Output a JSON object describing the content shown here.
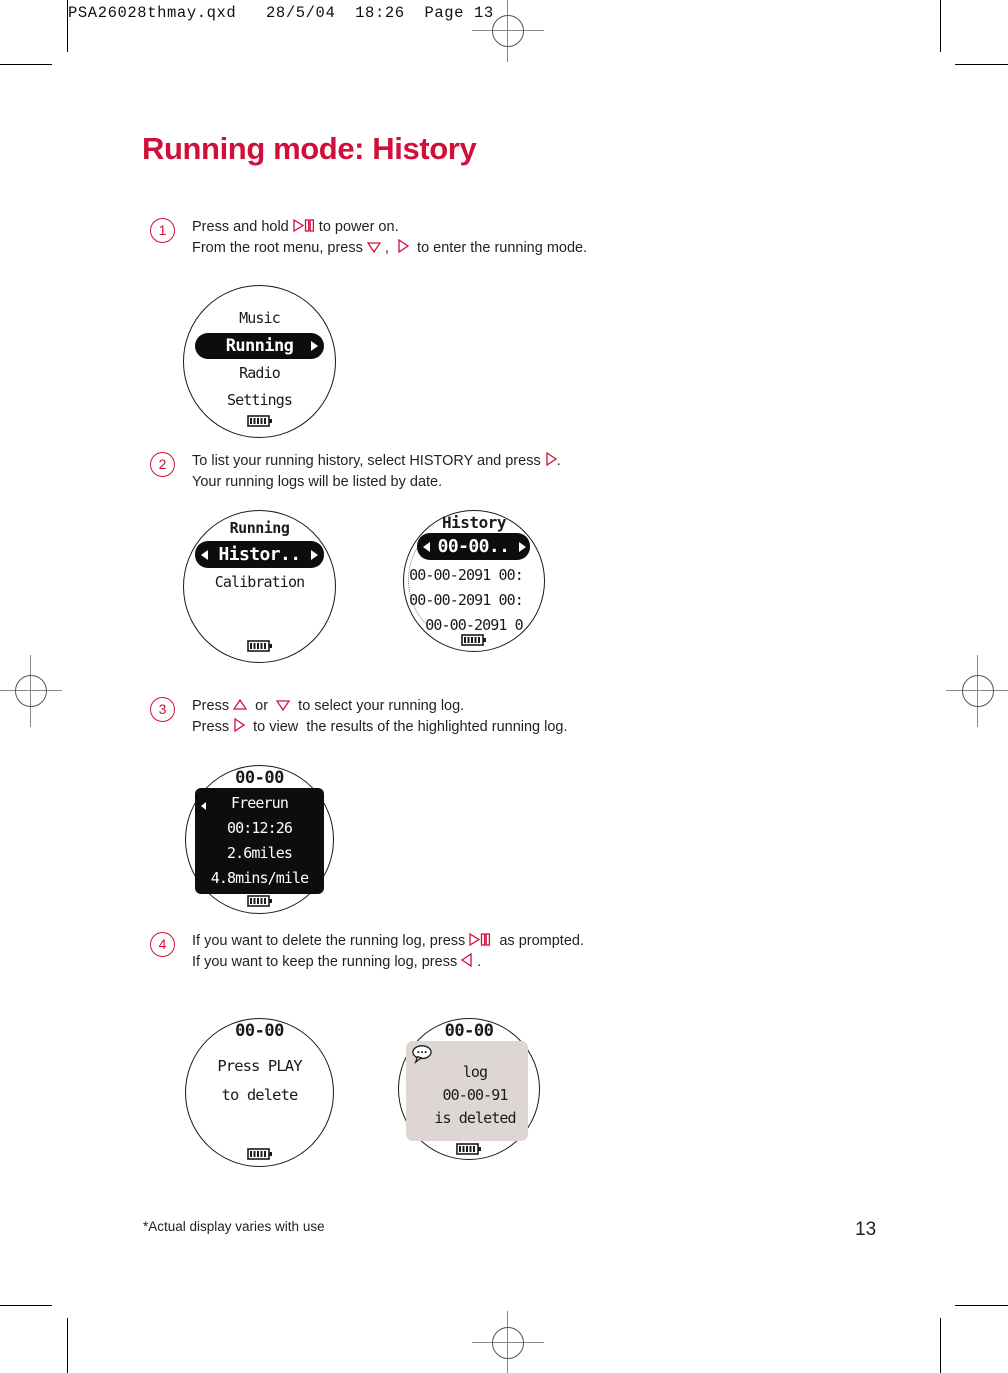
{
  "print_header": "PSA26028thmay.qxd   28/5/04  18:26  Page 13",
  "title": "Running mode: History",
  "steps": [
    {
      "number": "1",
      "lines": [
        {
          "parts": [
            {
              "t": "text",
              "v": "Press and hold "
            },
            {
              "t": "icon",
              "v": "play-pause-icon"
            },
            {
              "t": "text",
              "v": " to power on."
            }
          ]
        },
        {
          "parts": [
            {
              "t": "text",
              "v": "From the root menu, press "
            },
            {
              "t": "icon",
              "v": "down-triangle-icon"
            },
            {
              "t": "text",
              "v": " ,  "
            },
            {
              "t": "icon",
              "v": "right-triangle-icon"
            },
            {
              "t": "text",
              "v": "  to enter the running mode."
            }
          ]
        }
      ]
    },
    {
      "number": "2",
      "lines": [
        {
          "parts": [
            {
              "t": "text",
              "v": "To list your running history, select HISTORY and press "
            },
            {
              "t": "icon",
              "v": "right-triangle-icon"
            },
            {
              "t": "text",
              "v": "."
            }
          ]
        },
        {
          "parts": [
            {
              "t": "text",
              "v": "Your running logs will be listed by date."
            }
          ]
        }
      ]
    },
    {
      "number": "3",
      "lines": [
        {
          "parts": [
            {
              "t": "text",
              "v": "Press "
            },
            {
              "t": "icon",
              "v": "up-triangle-icon"
            },
            {
              "t": "text",
              "v": "  or  "
            },
            {
              "t": "icon",
              "v": "down-triangle-icon"
            },
            {
              "t": "text",
              "v": "  to select your running log."
            }
          ]
        },
        {
          "parts": [
            {
              "t": "text",
              "v": "Press "
            },
            {
              "t": "icon",
              "v": "right-triangle-icon"
            },
            {
              "t": "text",
              "v": "  to view  the results of the highlighted running log."
            }
          ]
        }
      ]
    },
    {
      "number": "4",
      "lines": [
        {
          "parts": [
            {
              "t": "text",
              "v": "If you want to delete the running log, press "
            },
            {
              "t": "icon",
              "v": "play-pause-icon"
            },
            {
              "t": "text",
              "v": "  as prompted."
            }
          ]
        },
        {
          "parts": [
            {
              "t": "text",
              "v": "If you want to keep the running log, press "
            },
            {
              "t": "icon",
              "v": "left-triangle-icon"
            },
            {
              "t": "text",
              "v": " ."
            }
          ]
        }
      ]
    }
  ],
  "screens": {
    "root_menu": {
      "name": "root-menu-screen",
      "items": [
        "Music",
        "Running",
        "Radio",
        "Settings"
      ],
      "selected": "Running",
      "selected_index": 1
    },
    "running_menu": {
      "name": "running-menu-screen",
      "header": "Running",
      "items": [
        "Histor..",
        "Calibration"
      ],
      "selected": "Histor..",
      "selected_index": 0
    },
    "history_list": {
      "name": "history-list-screen",
      "header": "History",
      "selected": "00-00..",
      "items": [
        "00-00-2091 00:",
        "00-00-2091 00:",
        "00-00-2091 0"
      ]
    },
    "log_results": {
      "name": "log-results-screen",
      "header": "00-00",
      "rows": [
        "Freerun",
        "00:12:26",
        "2.6miles",
        "4.8mins/mile"
      ]
    },
    "delete_prompt": {
      "name": "delete-prompt-screen",
      "header": "00-00",
      "rows": [
        "Press PLAY",
        "to delete"
      ]
    },
    "deleted_confirm": {
      "name": "deleted-confirm-screen",
      "header": "00-00",
      "rows": [
        "log",
        "00-00-91",
        "is deleted"
      ],
      "icon": "speech-bubble-icon"
    }
  },
  "footnote": "*Actual display varies with use",
  "page_number": "13",
  "colors": {
    "accent": "#d0103a",
    "text": "#231f20",
    "screen_dark": "#0d0d0d",
    "screen_grey": "#ddd6d2"
  }
}
